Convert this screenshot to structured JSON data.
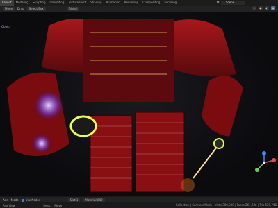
{
  "topbar": {
    "tabs": [
      "Layout",
      "Modeling",
      "Sculpting",
      "UV Editing",
      "Texture Paint",
      "Shading",
      "Animation",
      "Rendering",
      "Compositing",
      "Scripting"
    ],
    "scene": "Scene"
  },
  "toolbar": {
    "mode": "Mode",
    "drag": "Drag",
    "select": "Select Box",
    "transform": "Global",
    "object_label": "Object"
  },
  "bottombar": {
    "add": "Add",
    "mode": "Mode",
    "use_nodes": "Use Nodes",
    "slot": "Slot 1",
    "material": "Material.049"
  },
  "status": {
    "left": "Pan View",
    "mid1": "Select",
    "mid2": "Move",
    "stats": "Collection | Samurai Mesh | Verts 300,088 | Faces 261,746 | Tris 529,740"
  },
  "colors": {
    "accent_blue": "#4a6fa3",
    "armor_red": "#8a0f12",
    "neon": "#e6ff4a"
  }
}
